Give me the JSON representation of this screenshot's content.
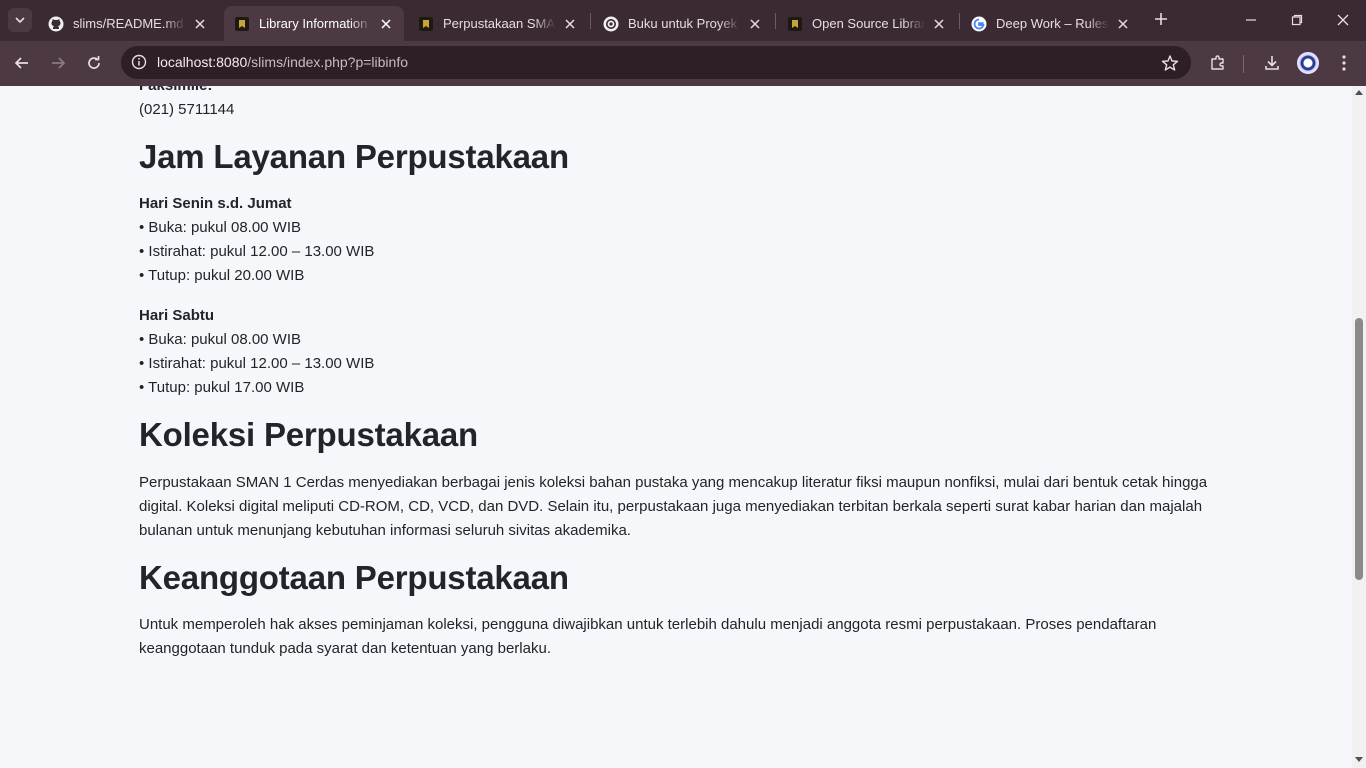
{
  "browser": {
    "tabs": [
      {
        "title": "slims/README.md at",
        "favicon": "github-icon",
        "active": false
      },
      {
        "title": "Library Information",
        "favicon": "slims-logo-icon",
        "active": true
      },
      {
        "title": "Perpustakaan SMAN",
        "favicon": "slims-logo-icon",
        "active": false
      },
      {
        "title": "Buku untuk Proyek S",
        "favicon": "openai-icon",
        "active": false
      },
      {
        "title": "Open Source Library",
        "favicon": "slims-logo-icon",
        "active": false
      },
      {
        "title": "Deep Work – Rules fo",
        "favicon": "google-icon",
        "active": false
      }
    ],
    "url_host": "localhost:8080",
    "url_path": "/slims/index.php?p=libinfo",
    "colors": {
      "frame": "#3b2a33",
      "toolbar": "#4d3944",
      "omnibox": "#2e1f27"
    }
  },
  "page": {
    "fax_label": "Faksimile:",
    "fax_number": "(021) 5711144",
    "hours": {
      "heading": "Jam Layanan Perpustakaan",
      "weekday_title": "Hari Senin s.d. Jumat",
      "weekday_open": "• Buka: pukul 08.00 WIB",
      "weekday_break": "• Istirahat: pukul 12.00 – 13.00 WIB",
      "weekday_close": "• Tutup: pukul 20.00 WIB",
      "saturday_title": "Hari Sabtu",
      "saturday_open": "• Buka: pukul 08.00 WIB",
      "saturday_break": "• Istirahat: pukul 12.00 – 13.00 WIB",
      "saturday_close": "• Tutup: pukul 17.00 WIB"
    },
    "collection": {
      "heading": "Koleksi Perpustakaan",
      "text": "Perpustakaan SMAN 1 Cerdas menyediakan berbagai jenis koleksi bahan pustaka yang mencakup literatur fiksi maupun nonfiksi, mulai dari bentuk cetak hingga digital. Koleksi digital meliputi CD-ROM, CD, VCD, dan DVD. Selain itu, perpustakaan juga menyediakan terbitan berkala seperti surat kabar harian dan majalah bulanan untuk menunjang kebutuhan informasi seluruh sivitas akademika."
    },
    "membership": {
      "heading": "Keanggotaan Perpustakaan",
      "text": "Untuk memperoleh hak akses peminjaman koleksi, pengguna diwajibkan untuk terlebih dahulu menjadi anggota resmi perpustakaan. Proses pendaftaran keanggotaan tunduk pada syarat dan ketentuan yang berlaku."
    }
  }
}
